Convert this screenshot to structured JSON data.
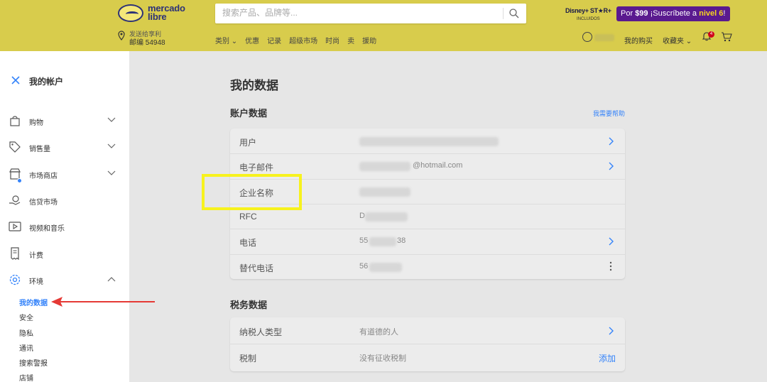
{
  "header": {
    "logo": {
      "line1": "mercado",
      "line2": "libre"
    },
    "ship": {
      "line1": "发送给享利",
      "line2": "邮编 54948"
    },
    "search_placeholder": "搜索产品、品牌等...",
    "nav": [
      "类别 ⌄",
      "优惠",
      "记录",
      "超级市场",
      "时尚",
      "卖",
      "援助"
    ],
    "disney": {
      "line1": "Disney+ ST★R+",
      "line2": "INCLUIDOS"
    },
    "promo": {
      "prefix": "Por ",
      "price": "$99",
      "middle": " ¡Suscríbete a ",
      "level": "nivel 6",
      "suffix": "!"
    },
    "my_purchases": "我的购买",
    "favorites": "收藏夹 ⌄",
    "notif_count": "4"
  },
  "sidebar": {
    "title": "我的帐户",
    "items": [
      {
        "label": "购物",
        "icon": "shopping-bag-icon",
        "chevron": "down"
      },
      {
        "label": "销售量",
        "icon": "tag-icon",
        "chevron": "down"
      },
      {
        "label": "市场商店",
        "icon": "store-icon",
        "chevron": "down"
      },
      {
        "label": "信贷市场",
        "icon": "credit-icon",
        "chevron": ""
      },
      {
        "label": "视频和音乐",
        "icon": "media-icon",
        "chevron": ""
      },
      {
        "label": "计费",
        "icon": "invoice-icon",
        "chevron": ""
      },
      {
        "label": "环境",
        "icon": "gear-icon",
        "chevron": "up"
      }
    ],
    "subitems": [
      "我的数据",
      "安全",
      "隐私",
      "通讯",
      "搜索警报",
      "店铺"
    ]
  },
  "main": {
    "title": "我的数据",
    "account_section": {
      "title": "账户数据",
      "help": "我需要帮助",
      "rows": [
        {
          "label": "用户",
          "value": ""
        },
        {
          "label": "电子邮件",
          "value": "@hotmail.com"
        },
        {
          "label": "企业名称",
          "value": ""
        },
        {
          "label": "RFC",
          "value": "D"
        },
        {
          "label": "电话",
          "value_a": "55",
          "value_b": "38"
        },
        {
          "label": "替代电话",
          "value": "56"
        }
      ]
    },
    "tax_section": {
      "title": "税务数据",
      "rows": [
        {
          "label": "纳税人类型",
          "value": "有道德的人"
        },
        {
          "label": "税制",
          "value": "没有征收税制",
          "action": "添加"
        }
      ]
    }
  },
  "colors": {
    "header": "#d8cc4c",
    "accent": "#3483fa",
    "highlight": "#f7f21e",
    "arrow": "#e53935",
    "promo": "#5a1a8f"
  }
}
